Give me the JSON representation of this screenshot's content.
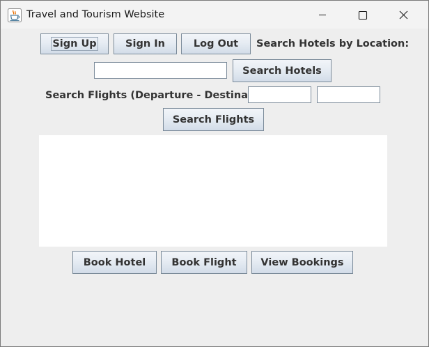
{
  "window": {
    "title": "Travel and Tourism Website",
    "app_icon": "java-coffee-cup-icon",
    "controls": [
      "minimize-icon",
      "maximize-icon",
      "close-icon"
    ]
  },
  "auth": {
    "sign_up_label": "Sign Up",
    "sign_in_label": "Sign In",
    "log_out_label": "Log Out"
  },
  "hotels": {
    "search_label": "Search Hotels by Location:",
    "location_value": "",
    "search_button_label": "Search Hotels"
  },
  "flights": {
    "search_label": "Search Flights (Departure - Destination):",
    "departure_value": "",
    "destination_value": "",
    "search_button_label": "Search Flights"
  },
  "results": {
    "text": ""
  },
  "actions": {
    "book_hotel_label": "Book Hotel",
    "book_flight_label": "Book Flight",
    "view_bookings_label": "View Bookings"
  }
}
